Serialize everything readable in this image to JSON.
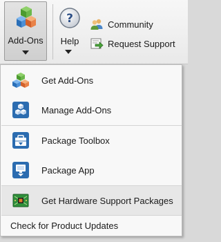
{
  "ribbon": {
    "addons": {
      "label": "Add-Ons",
      "icon": "cubes-icon"
    },
    "help": {
      "label": "Help",
      "icon": "question-icon"
    },
    "community": {
      "label": "Community",
      "icon": "users-icon"
    },
    "request_support": {
      "label": "Request Support",
      "icon": "support-arrow-icon"
    }
  },
  "menu": {
    "items": [
      {
        "label": "Get Add-Ons",
        "icon": "cubes-icon"
      },
      {
        "label": "Manage Add-Ons",
        "icon": "manage-addons-icon"
      },
      {
        "label": "Package Toolbox",
        "icon": "toolbox-icon"
      },
      {
        "label": "Package App",
        "icon": "package-app-icon"
      },
      {
        "label": "Get Hardware Support Packages",
        "icon": "circuit-board-icon"
      },
      {
        "label": "Check for Product Updates"
      }
    ]
  },
  "colors": {
    "menu_highlight": "#e7e7e7",
    "icon_blue": "#2b6cb0",
    "board_green": "#2f8f3a"
  }
}
